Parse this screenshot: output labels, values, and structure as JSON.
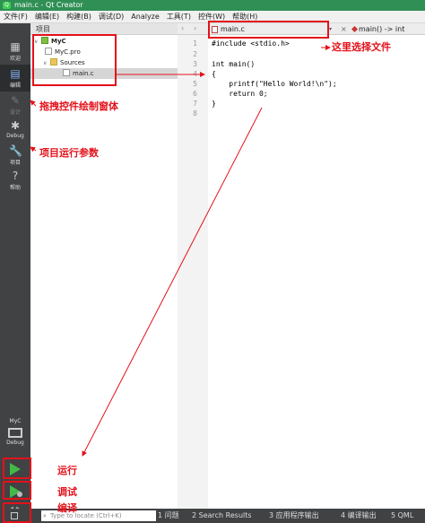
{
  "titlebar": {
    "title": "main.c - Qt Creator"
  },
  "menu": [
    "文件(F)",
    "编辑(E)",
    "构建(B)",
    "调试(D)",
    "Analyze",
    "工具(T)",
    "控件(W)",
    "帮助(H)"
  ],
  "modes": {
    "welcome": "欢迎",
    "edit": "编辑",
    "design": "设计",
    "debug": "Debug",
    "projects": "项目",
    "help": "帮助"
  },
  "kit": {
    "name": "MyC",
    "mode": "Debug"
  },
  "project_panel": {
    "title": "项目"
  },
  "tree": {
    "project": "MyC",
    "pro_file": "MyC.pro",
    "sources": "Sources",
    "file": "main.c"
  },
  "editor": {
    "file_combo": "main.c",
    "symbol_combo": "main() -> int",
    "line_numbers": [
      "1",
      "2",
      "3",
      "4",
      "5",
      "6",
      "7",
      "8"
    ],
    "lines": [
      "#include <stdio.h>",
      "",
      "int main()",
      "{",
      "    printf(\"Hello World!\\n\");",
      "    return 0;",
      "}",
      ""
    ]
  },
  "statusbar": {
    "locate_placeholder": "Type to locate (Ctrl+K)",
    "panes": [
      "1 问题",
      "2 Search Results",
      "3 应用程序输出",
      "4 编译输出",
      "5 QML"
    ]
  },
  "annotations": {
    "select_file": "这里选择文件",
    "drag_controls": "拖拽控件绘制窗体",
    "project_params": "项目运行参数",
    "run": "运行",
    "debug": "调试",
    "build": "编译"
  },
  "colors": {
    "annotation": "#e3111a",
    "titlebar": "#2f8f54",
    "sidebar": "#404244",
    "run_green": "#44b84a"
  }
}
